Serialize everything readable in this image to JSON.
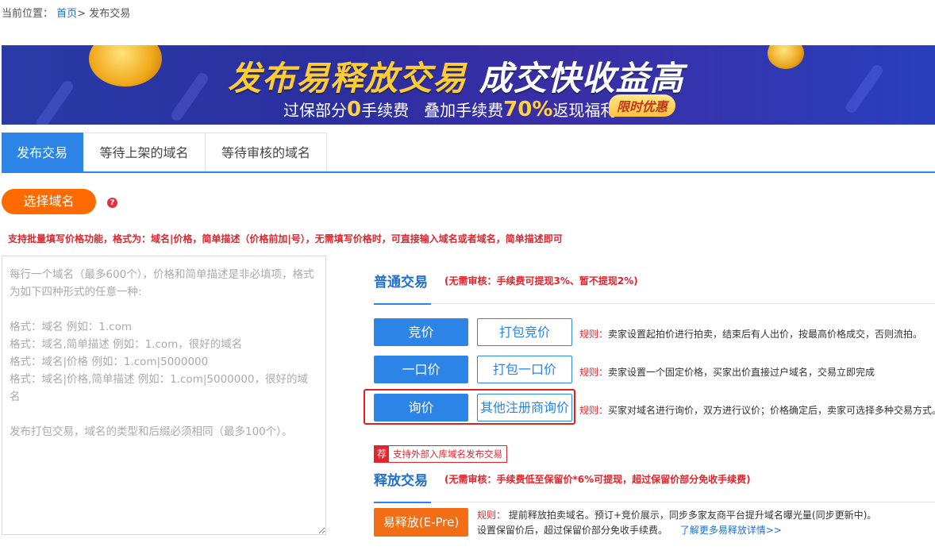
{
  "breadcrumb": {
    "label": "当前位置：",
    "home": "首页",
    "sep": ">",
    "current": "发布交易"
  },
  "banner": {
    "title_a": "发布易释放交易",
    "title_b": "成交快收益高",
    "sub_1": "过保部分",
    "sub_zero": "0",
    "sub_2": "手续费   叠加手续费",
    "sub_pct": "70%",
    "sub_3": "返现福利",
    "badge": "限时优惠"
  },
  "tabs": [
    {
      "label": "发布交易",
      "active": true
    },
    {
      "label": "等待上架的域名",
      "active": false
    },
    {
      "label": "等待审核的域名",
      "active": false
    }
  ],
  "select_button": "选择域名",
  "help_icon": "?",
  "notice": "支持批量填写价格功能，格式为：域名|价格，简单描述（价格前加|号），无需填写价格时，可直接输入域名或者域名，简单描述即可",
  "textarea": {
    "placeholder": "每行一个域名（最多600个），价格和简单描述是非必填项，格式为如下四种形式的任意一种:\n\n格式：域名 例如：1.com\n格式：域名,简单描述 例如：1.com，很好的域名\n格式：域名|价格 例如：1.com|5000000\n格式：域名|价格,简单描述 例如：1.com|5000000，很好的域名\n\n发布打包交易，域名的类型和后缀必须相同（最多100个）。"
  },
  "normal": {
    "title": "普通交易",
    "note": "(无需审核：手续费可提现3%、暂不提现2%)",
    "rows": [
      {
        "solid": "竞价",
        "outline": "打包竞价",
        "rule_label": "规则：",
        "rule": "卖家设置起拍价进行拍卖，结束后有人出价，按最高价格成交，否则流拍。"
      },
      {
        "solid": "一口价",
        "outline": "打包一口价",
        "rule_label": "规则：",
        "rule": "卖家设置一个固定价格，买家出价直接过户域名，交易立即完成"
      },
      {
        "solid": "询价",
        "outline": "其他注册商询价",
        "rule_label": "规则：",
        "rule": "买家对域名进行询价，双方进行议价；价格确定后，卖家可选择多种交易方式。"
      }
    ]
  },
  "release": {
    "tag_icon": "荐",
    "tag_text": "支持外部入库域名发布交易",
    "title": "释放交易",
    "note": "(无需审核：手续费低至保留价*6%可提现，超过保留价部分免收手续费)",
    "button": "易释放(E-Pre)",
    "rule_label": "规则：",
    "rule_line1": "提前释放拍卖域名。预订+竞价展示，同步多家友商平台提升域名曝光量(同步更新中)。",
    "rule_line2": "设置保留价后，超过保留价部分免收手续费。",
    "more_link": "了解更多易释放详情>>"
  }
}
